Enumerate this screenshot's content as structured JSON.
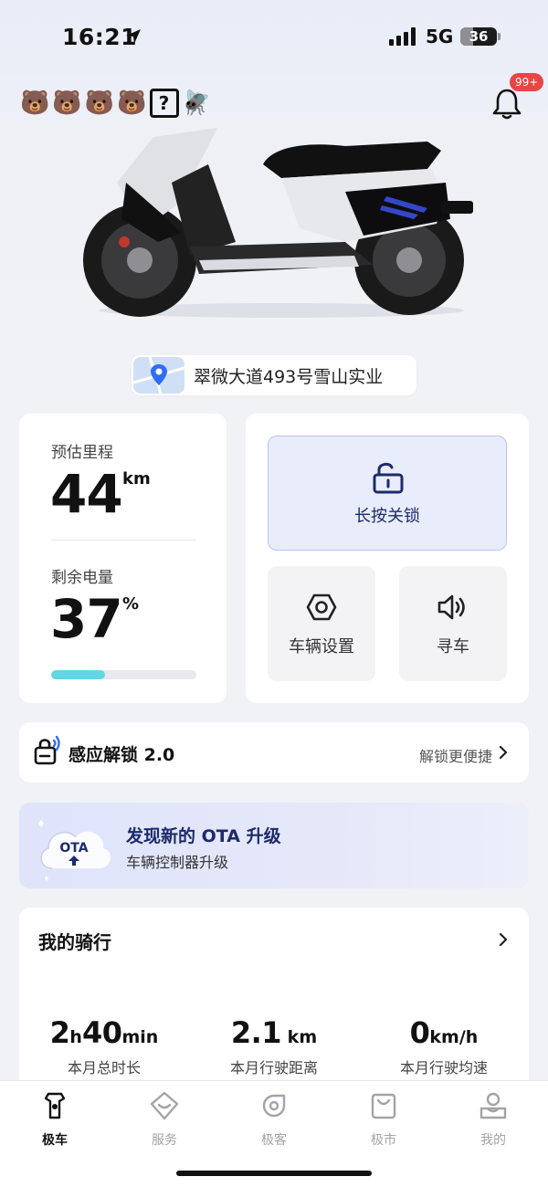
{
  "status_bar": {
    "time": "16:21",
    "network": "5G",
    "battery": "36",
    "battery_level": 0.36
  },
  "header": {
    "emojis": [
      "🐻",
      "🐻",
      "🐻",
      "🐻"
    ],
    "question_box": "?",
    "fly": "🪰",
    "notification_badge": "99+"
  },
  "location": {
    "address": "翠微大道493号雪山实业"
  },
  "range": {
    "label": "预估里程",
    "value": "44",
    "unit": "km"
  },
  "battery_card": {
    "label": "剩余电量",
    "value": "37",
    "unit": "%",
    "level": 0.37
  },
  "controls": {
    "lock_label": "长按关锁",
    "settings_label": "车辆设置",
    "find_label": "寻车"
  },
  "induction_unlock": {
    "title": "感应解锁 2.0",
    "hint": "解锁更便捷"
  },
  "ota": {
    "badge": "OTA",
    "title": "发现新的 OTA 升级",
    "subtitle": "车辆控制器升级"
  },
  "my_ride": {
    "title": "我的骑行",
    "stats": [
      {
        "parts": [
          [
            "2",
            "val"
          ],
          [
            "h",
            "u"
          ],
          [
            "40",
            "val"
          ],
          [
            "min",
            "u"
          ]
        ],
        "caption": "本月总时长"
      },
      {
        "parts": [
          [
            "2.1",
            "val"
          ],
          [
            " km",
            "u"
          ]
        ],
        "caption": "本月行驶距离"
      },
      {
        "parts": [
          [
            "0",
            "val"
          ],
          [
            "km/h",
            "u"
          ]
        ],
        "caption": "本月行驶均速"
      }
    ]
  },
  "tabs": [
    {
      "label": "极车",
      "icon": "scooter-icon",
      "active": true
    },
    {
      "label": "服务",
      "icon": "service-icon",
      "active": false
    },
    {
      "label": "极客",
      "icon": "geek-icon",
      "active": false
    },
    {
      "label": "极市",
      "icon": "shop-icon",
      "active": false
    },
    {
      "label": "我的",
      "icon": "profile-icon",
      "active": false
    }
  ],
  "colors": {
    "accent": "#1d2a6b",
    "progress": "#5fd8e3",
    "badge": "#e84545"
  }
}
